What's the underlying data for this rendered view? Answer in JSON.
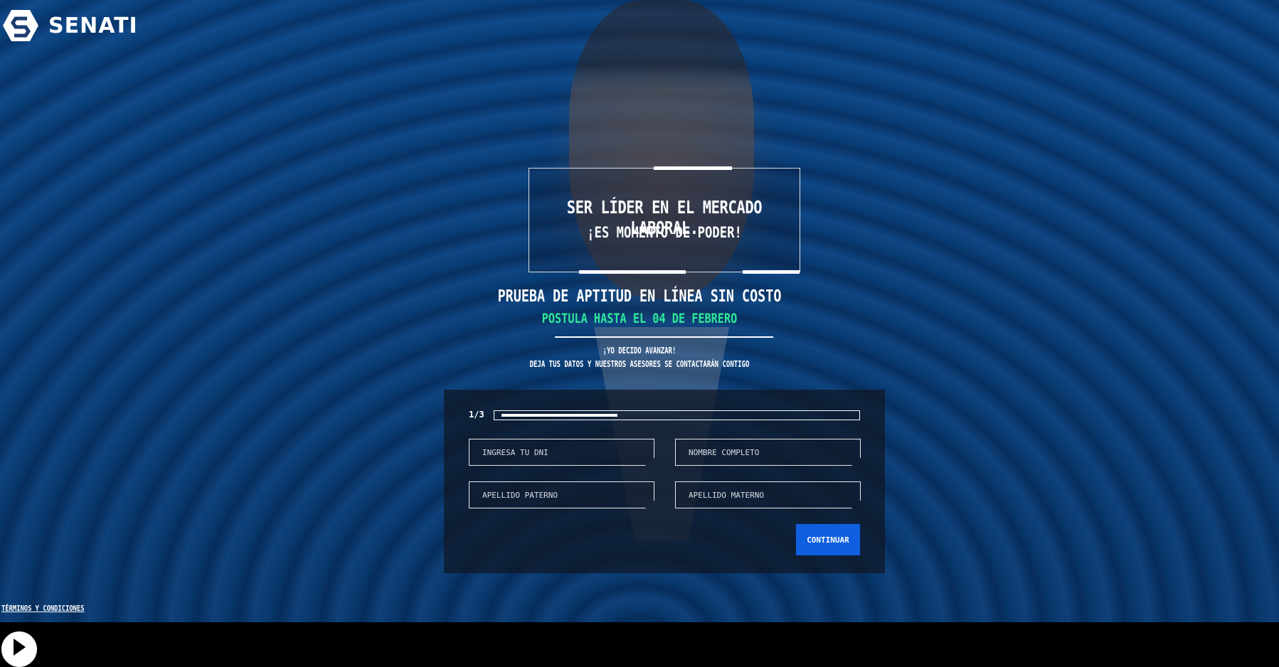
{
  "brand": {
    "name": "SENATI",
    "logo_icon": "senati-logo-icon"
  },
  "banner": {
    "title": "SER LÍDER EN EL MERCADO LABORAL.",
    "subtitle": "¡ES MOMENTO DE PODER!"
  },
  "promo": {
    "headline": "PRUEBA DE APTITUD EN LÍNEA SIN COSTO",
    "deadline": "POSTULA HASTA EL 04 DE FEBRERO",
    "cta_line1": "¡YO DECIDO AVANZAR!",
    "cta_line2": "DEJA TUS DATOS Y NUESTROS ASESORES SE CONTACTARÁN CONTIGO"
  },
  "form": {
    "step_label": "1/3",
    "progress": 0.33,
    "fields": {
      "dni_placeholder": "INGRESA TU DNI",
      "name_placeholder": "NOMBRE COMPLETO",
      "paternal_placeholder": "APELLIDO PATERNO",
      "maternal_placeholder": "APELLIDO MATERNO"
    },
    "submit_label": "CONTINUAR"
  },
  "footer": {
    "terms_link": "TÉRMINOS Y CONDICIONES",
    "play_icon": "play-icon"
  },
  "colors": {
    "accent_green": "#2ee89a",
    "button_blue": "#0f5fe0",
    "background_blue": "#0b4a8c"
  }
}
